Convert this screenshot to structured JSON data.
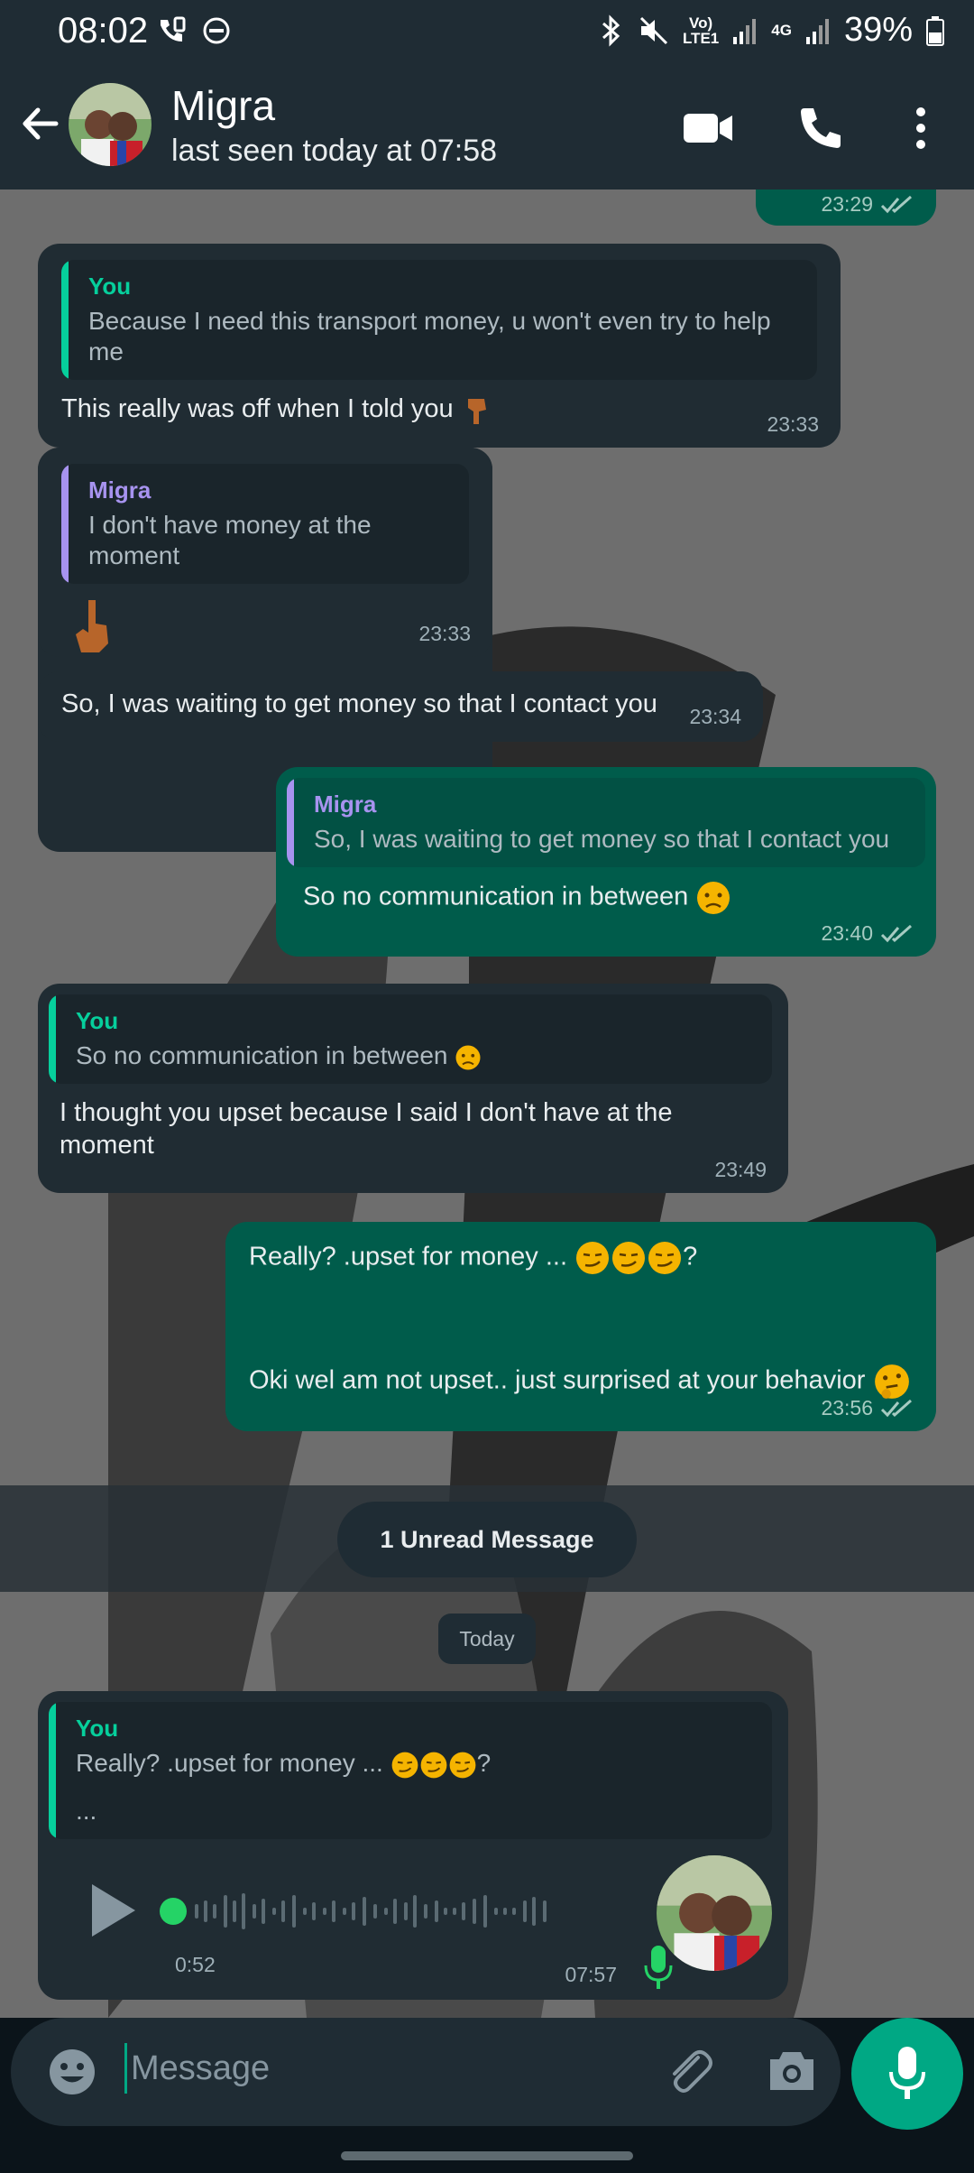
{
  "status_bar": {
    "time": "08:02",
    "network_1": "Vo)\nLTE1",
    "network_2": "4G",
    "battery": "39%"
  },
  "header": {
    "contact_name": "Migra",
    "last_seen": "last seen today at 07:58"
  },
  "messages": [
    {
      "time": "23:29"
    },
    {
      "quote_author": "You",
      "quote_text": "Because I need this transport money,  u won't even try to help me",
      "text": "This really was off when I told you",
      "time": "23:33"
    },
    {
      "quote_author": "Migra",
      "quote_text": "I don't have money at the moment",
      "time": "23:33"
    },
    {
      "text": "So, I was waiting to get money so that I contact you",
      "time": "23:34"
    },
    {
      "quote_author": "Migra",
      "quote_text": "So, I was waiting to get money so that I contact you",
      "text": "So no communication in between",
      "time": "23:40"
    },
    {
      "quote_author": "You",
      "quote_text": "So no communication in between",
      "text": "I thought you upset because I said I don't have at the moment",
      "time": "23:49"
    },
    {
      "text_1": "Really? .upset for money ...",
      "text_1_end": "?",
      "text_2": "Oki wel am not upset.. just surprised at your behavior",
      "time": "23:56"
    },
    {
      "quote_author": "You",
      "quote_text": "Really? .upset for money ...",
      "quote_text_end": "?",
      "quote_text_2": "...",
      "voice_duration": "0:52",
      "time": "07:57"
    }
  ],
  "unread_label": "1 Unread Message",
  "date_label": "Today",
  "input": {
    "placeholder": "Message"
  },
  "colors": {
    "header_bg": "#1f2c34",
    "incoming_bubble": "#202c33",
    "outgoing_bubble": "#005c4b",
    "accent": "#00a884",
    "quote_you": "#06cf9c",
    "quote_migra": "#a793ef"
  }
}
